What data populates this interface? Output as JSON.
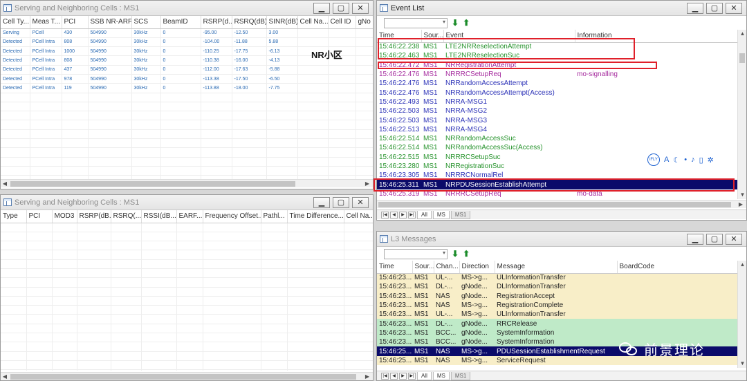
{
  "serving_top": {
    "title": "Serving and Neighboring Cells : MS1",
    "columns": [
      "Cell Ty...",
      "Meas T...",
      "PCI",
      "SSB NR-ARF...",
      "SCS",
      "BeamID",
      "RSRP(d...",
      "RSRQ(dB)",
      "SINR(dB)",
      "Cell Na...",
      "Cell ID",
      "gNo"
    ],
    "rows": [
      [
        "Serving",
        "PCell",
        "430",
        "504990",
        "30kHz",
        "0",
        "-95.00",
        "-12.50",
        "3.00",
        "",
        "",
        ""
      ],
      [
        "Detected",
        "PCell Intra",
        "808",
        "504990",
        "30kHz",
        "0",
        "-104.00",
        "-11.88",
        "5.88",
        "",
        "",
        ""
      ],
      [
        "Detected",
        "PCell Intra",
        "1000",
        "504990",
        "30kHz",
        "0",
        "-110.25",
        "-17.75",
        "-6.13",
        "",
        "",
        ""
      ],
      [
        "Detected",
        "PCell Intra",
        "808",
        "504990",
        "30kHz",
        "0",
        "-110.38",
        "-16.00",
        "-4.13",
        "",
        "",
        ""
      ],
      [
        "Detected",
        "PCell Intra",
        "437",
        "504990",
        "30kHz",
        "0",
        "-112.00",
        "-17.63",
        "-5.88",
        "",
        "",
        ""
      ],
      [
        "Detected",
        "PCell Intra",
        "978",
        "504990",
        "30kHz",
        "0",
        "-113.38",
        "-17.50",
        "-6.50",
        "",
        "",
        ""
      ],
      [
        "Detected",
        "PCell Intra",
        "119",
        "504990",
        "30kHz",
        "0",
        "-113.88",
        "-18.00",
        "-7.75",
        "",
        "",
        ""
      ]
    ],
    "annotation": "NR小区"
  },
  "serving_bottom": {
    "title": "Serving and Neighboring Cells : MS1",
    "columns": [
      "Type",
      "PCI",
      "MOD3",
      "RSRP(dB...",
      "RSRQ(...",
      "RSSI(dB...",
      "EARF...",
      "Frequency Offset...",
      "Pathl...",
      "Time Difference...",
      "Cell Na..."
    ]
  },
  "event_list": {
    "title": "Event List",
    "columns": [
      "Time",
      "Sour...",
      "Event",
      "Information"
    ],
    "rows": [
      {
        "time": "15:46:22.238",
        "src": "MS1",
        "event": "LTE2NRReselectionAttempt",
        "info": "",
        "style": "green"
      },
      {
        "time": "15:46:22.463",
        "src": "MS1",
        "event": "LTE2NRReselectionSuc",
        "info": "",
        "style": "green"
      },
      {
        "time": "15:46:22.472",
        "src": "MS1",
        "event": "NRRegistrationAttempt",
        "info": "",
        "style": "purple"
      },
      {
        "time": "15:46:22.476",
        "src": "MS1",
        "event": "NRRRCSetupReq",
        "info": "mo-signalling",
        "style": "purple"
      },
      {
        "time": "15:46:22.476",
        "src": "MS1",
        "event": "NRRandomAccessAttempt",
        "info": "",
        "style": "blue"
      },
      {
        "time": "15:46:22.476",
        "src": "MS1",
        "event": "NRRandomAccessAttempt(Access)",
        "info": "",
        "style": "blue"
      },
      {
        "time": "15:46:22.493",
        "src": "MS1",
        "event": "NRRA-MSG1",
        "info": "",
        "style": "blue"
      },
      {
        "time": "15:46:22.503",
        "src": "MS1",
        "event": "NRRA-MSG2",
        "info": "",
        "style": "blue"
      },
      {
        "time": "15:46:22.503",
        "src": "MS1",
        "event": "NRRA-MSG3",
        "info": "",
        "style": "blue"
      },
      {
        "time": "15:46:22.513",
        "src": "MS1",
        "event": "NRRA-MSG4",
        "info": "",
        "style": "blue"
      },
      {
        "time": "15:46:22.514",
        "src": "MS1",
        "event": "NRRandomAccessSuc",
        "info": "",
        "style": "green"
      },
      {
        "time": "15:46:22.514",
        "src": "MS1",
        "event": "NRRandomAccessSuc(Access)",
        "info": "",
        "style": "green"
      },
      {
        "time": "15:46:22.515",
        "src": "MS1",
        "event": "NRRRCSetupSuc",
        "info": "",
        "style": "green"
      },
      {
        "time": "15:46:23.280",
        "src": "MS1",
        "event": "NRRegistrationSuc",
        "info": "",
        "style": "green"
      },
      {
        "time": "15:46:23.305",
        "src": "MS1",
        "event": "NRRRCNormalRel",
        "info": "",
        "style": "blue"
      },
      {
        "time": "15:46:25.311",
        "src": "MS1",
        "event": "NRPDUSessionEstablishAttempt",
        "info": "",
        "style": "sel"
      },
      {
        "time": "15:46:25.319",
        "src": "MS1",
        "event": "NRRRCSetupReq",
        "info": "mo-data",
        "style": "purple"
      }
    ],
    "tabs": [
      "All",
      "MS",
      "MS1"
    ]
  },
  "l3": {
    "title": "L3 Messages",
    "columns": [
      "Time",
      "Sour...",
      "Chan...",
      "Direction",
      "Message",
      "BoardCode"
    ],
    "rows": [
      {
        "time": "15:46:23...",
        "src": "MS1",
        "chan": "UL-...",
        "dir": "MS->g...",
        "msg": "ULInformationTransfer",
        "style": "yl"
      },
      {
        "time": "15:46:23...",
        "src": "MS1",
        "chan": "DL-...",
        "dir": "gNode...",
        "msg": "DLInformationTransfer",
        "style": "yl"
      },
      {
        "time": "15:46:23...",
        "src": "MS1",
        "chan": "NAS",
        "dir": "gNode...",
        "msg": "RegistrationAccept",
        "style": "yl"
      },
      {
        "time": "15:46:23...",
        "src": "MS1",
        "chan": "NAS",
        "dir": "MS->g...",
        "msg": "RegistrationComplete",
        "style": "yl"
      },
      {
        "time": "15:46:23...",
        "src": "MS1",
        "chan": "UL-...",
        "dir": "MS->g...",
        "msg": "ULInformationTransfer",
        "style": "yl"
      },
      {
        "time": "15:46:23...",
        "src": "MS1",
        "chan": "DL-...",
        "dir": "gNode...",
        "msg": "RRCRelease",
        "style": "gr"
      },
      {
        "time": "15:46:23...",
        "src": "MS1",
        "chan": "BCC...",
        "dir": "gNode...",
        "msg": "SystemInformation",
        "style": "gr"
      },
      {
        "time": "15:46:23...",
        "src": "MS1",
        "chan": "BCC...",
        "dir": "gNode...",
        "msg": "SystemInformation",
        "style": "gr"
      },
      {
        "time": "15:46:25...",
        "src": "MS1",
        "chan": "NAS",
        "dir": "MS->g...",
        "msg": "PDUSessionEstablishmentRequest",
        "style": "sel"
      },
      {
        "time": "15:46:25...",
        "src": "MS1",
        "chan": "NAS",
        "dir": "MS->g...",
        "msg": "ServiceRequest",
        "style": "yl"
      }
    ],
    "tabs": [
      "All",
      "MS",
      "MS1"
    ]
  },
  "watermark": "前景理论",
  "floatbar": {
    "logo": "iFLY",
    "glyph": "A"
  },
  "icons": {
    "minimize": "minimize-icon",
    "restore": "restore-icon",
    "close": "close-icon"
  }
}
